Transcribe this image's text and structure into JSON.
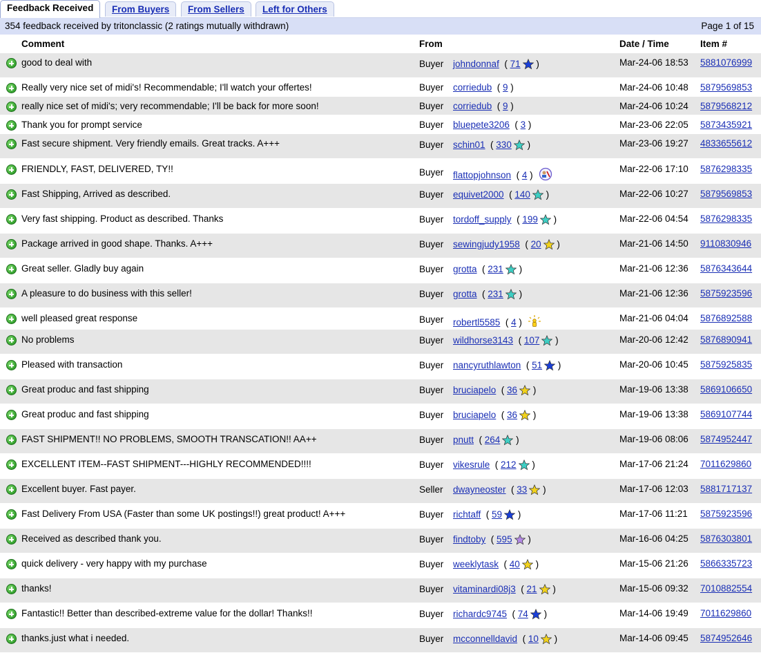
{
  "tabs": [
    "Feedback Received",
    "From Buyers",
    "From Sellers",
    "Left for Others"
  ],
  "summary": {
    "text": "354 feedback received by tritonclassic (2 ratings mutually withdrawn)",
    "page": "Page 1 of 15"
  },
  "columns": {
    "comment": "Comment",
    "from": "From",
    "date": "Date / Time",
    "item": "Item #"
  },
  "colors": {
    "star_blue": "#1a3fd8",
    "star_turquoise": "#3ecfc4",
    "star_yellow": "#f2d21c",
    "star_purple": "#b58ae6",
    "link": "#1a2fb5",
    "row_alt": "#e6e6e6",
    "summary_bg": "#d8dff6"
  },
  "rows": [
    {
      "comment": "good to deal with",
      "role": "Buyer",
      "user": "johndonnaf",
      "score": "71",
      "star": "blue",
      "date": "Mar-24-06 18:53",
      "item": "5881076999"
    },
    {
      "comment": "Really very nice set of midi's! Recommendable; I'll watch your offertes!",
      "role": "Buyer",
      "user": "corriedub",
      "score": "9",
      "star": "",
      "date": "Mar-24-06 10:48",
      "item": "5879569853"
    },
    {
      "comment": "really nice set of midi's; very recommendable; I'll be back for more soon!",
      "role": "Buyer",
      "user": "corriedub",
      "score": "9",
      "star": "",
      "date": "Mar-24-06 10:24",
      "item": "5879568212"
    },
    {
      "comment": "Thank you for prompt service",
      "role": "Buyer",
      "user": "bluepete3206",
      "score": "3",
      "star": "",
      "date": "Mar-23-06 22:05",
      "item": "5873435921"
    },
    {
      "comment": "Fast secure shipment. Very friendly emails. Great tracks. A+++",
      "role": "Buyer",
      "user": "schin01",
      "score": "330",
      "star": "turquoise",
      "date": "Mar-23-06 19:27",
      "item": "4833655612"
    },
    {
      "comment": "FRIENDLY, FAST, DELIVERED, TY!!",
      "role": "Buyer",
      "user": "flattopjohnson",
      "score": "4",
      "star": "",
      "extra": "id-icon",
      "date": "Mar-22-06 17:10",
      "item": "5876298335"
    },
    {
      "comment": "Fast Shipping, Arrived as described.",
      "role": "Buyer",
      "user": "equivet2000",
      "score": "140",
      "star": "turquoise",
      "date": "Mar-22-06 10:27",
      "item": "5879569853"
    },
    {
      "comment": "Very fast shipping. Product as described. Thanks",
      "role": "Buyer",
      "user": "tordoff_supply",
      "score": "199",
      "star": "turquoise",
      "date": "Mar-22-06 04:54",
      "item": "5876298335"
    },
    {
      "comment": "Package arrived in good shape. Thanks. A+++",
      "role": "Buyer",
      "user": "sewingjudy1958",
      "score": "20",
      "star": "yellow",
      "date": "Mar-21-06 14:50",
      "item": "9110830946"
    },
    {
      "comment": "Great seller. Gladly buy again",
      "role": "Buyer",
      "user": "grotta",
      "score": "231",
      "star": "turquoise",
      "date": "Mar-21-06 12:36",
      "item": "5876343644"
    },
    {
      "comment": "A pleasure to do business with this seller!",
      "role": "Buyer",
      "user": "grotta",
      "score": "231",
      "star": "turquoise",
      "date": "Mar-21-06 12:36",
      "item": "5875923596"
    },
    {
      "comment": "well pleased great response",
      "role": "Buyer",
      "user": "robertl5585",
      "score": "4",
      "star": "",
      "extra": "new-user-icon",
      "date": "Mar-21-06 04:04",
      "item": "5876892588"
    },
    {
      "comment": "No problems",
      "role": "Buyer",
      "user": "wildhorse3143",
      "score": "107",
      "star": "turquoise",
      "date": "Mar-20-06 12:42",
      "item": "5876890941"
    },
    {
      "comment": "Pleased with transaction",
      "role": "Buyer",
      "user": "nancyruthlawton",
      "score": "51",
      "star": "blue",
      "date": "Mar-20-06 10:45",
      "item": "5875925835"
    },
    {
      "comment": "Great produc and fast shipping",
      "role": "Buyer",
      "user": "bruciapelo",
      "score": "36",
      "star": "yellow",
      "date": "Mar-19-06 13:38",
      "item": "5869106650"
    },
    {
      "comment": "Great produc and fast shipping",
      "role": "Buyer",
      "user": "bruciapelo",
      "score": "36",
      "star": "yellow",
      "date": "Mar-19-06 13:38",
      "item": "5869107744"
    },
    {
      "comment": "FAST SHIPMENT!! NO PROBLEMS, SMOOTH TRANSCATION!! AA++",
      "role": "Buyer",
      "user": "pnutt",
      "score": "264",
      "star": "turquoise",
      "date": "Mar-19-06 08:06",
      "item": "5874952447"
    },
    {
      "comment": "EXCELLENT ITEM--FAST SHIPMENT---HIGHLY RECOMMENDED!!!!",
      "role": "Buyer",
      "user": "vikesrule",
      "score": "212",
      "star": "turquoise",
      "date": "Mar-17-06 21:24",
      "item": "7011629860"
    },
    {
      "comment": "Excellent buyer. Fast payer.",
      "role": "Seller",
      "user": "dwayneoster",
      "score": "33",
      "star": "yellow",
      "date": "Mar-17-06 12:03",
      "item": "5881717137"
    },
    {
      "comment": "Fast Delivery From USA (Faster than some UK postings!!) great product! A+++",
      "role": "Buyer",
      "user": "richtaff",
      "score": "59",
      "star": "blue",
      "date": "Mar-17-06 11:21",
      "item": "5875923596"
    },
    {
      "comment": "Received as described thank you.",
      "role": "Buyer",
      "user": "findtoby",
      "score": "595",
      "star": "purple",
      "date": "Mar-16-06 04:25",
      "item": "5876303801"
    },
    {
      "comment": "quick delivery - very happy with my purchase",
      "role": "Buyer",
      "user": "weeklytask",
      "score": "40",
      "star": "yellow",
      "date": "Mar-15-06 21:26",
      "item": "5866335723"
    },
    {
      "comment": "thanks!",
      "role": "Buyer",
      "user": "vitaminardi08j3",
      "score": "21",
      "star": "yellow",
      "date": "Mar-15-06 09:32",
      "item": "7010882554"
    },
    {
      "comment": "Fantastic!! Better than described-extreme value for the dollar! Thanks!!",
      "role": "Buyer",
      "user": "richardc9745",
      "score": "74",
      "star": "blue",
      "date": "Mar-14-06 19:49",
      "item": "7011629860"
    },
    {
      "comment": "thanks.just what i needed.",
      "role": "Buyer",
      "user": "mcconnelldavid",
      "score": "10",
      "star": "yellow",
      "date": "Mar-14-06 09:45",
      "item": "5874952646"
    }
  ]
}
